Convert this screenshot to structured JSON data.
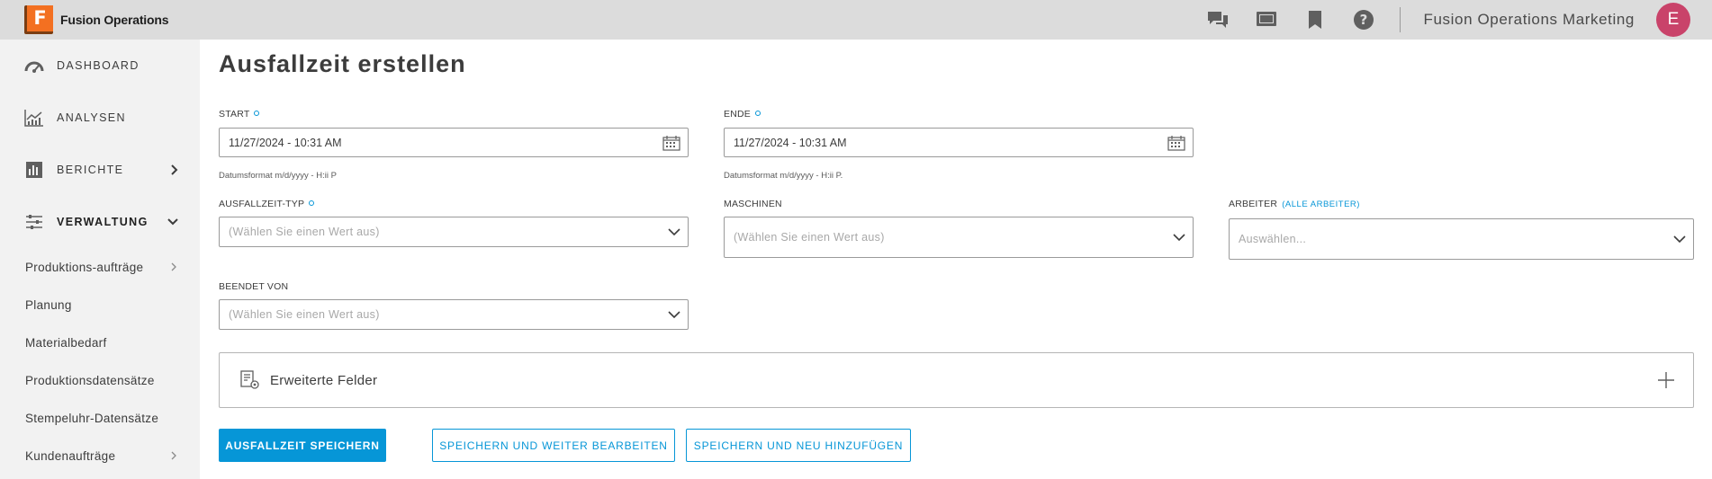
{
  "app": {
    "name": "Fusion Operations",
    "logo_letter": "F",
    "org": "Fusion Operations Marketing",
    "user_initial": "E",
    "accent": "#0696d7",
    "brand_color": "#f37021"
  },
  "topbar": {
    "icons": [
      "chat-icon",
      "presentation-icon",
      "bookmark-icon",
      "help-icon"
    ]
  },
  "sidebar": {
    "main_items": [
      {
        "label": "DASHBOARD",
        "icon": "dashboard-gauge-icon"
      },
      {
        "label": "ANALYSEN",
        "icon": "analytics-icon"
      },
      {
        "label": "BERICHTE",
        "icon": "reports-icon"
      },
      {
        "label": "VERWALTUNG",
        "icon": "sliders-icon"
      }
    ],
    "sub_items": [
      {
        "label": "Produktions-aufträge"
      },
      {
        "label": "Planung"
      },
      {
        "label": "Materialbedarf"
      },
      {
        "label": "Produktionsdatensätze"
      },
      {
        "label": "Stempeluhr-Datensätze"
      },
      {
        "label": "Kundenaufträge"
      }
    ]
  },
  "page": {
    "title": "Ausfallzeit erstellen"
  },
  "form": {
    "start": {
      "label": "START",
      "value": "11/27/2024 - 10:31 AM",
      "hint": "Datumsformat m/d/yyyy - H:ii P"
    },
    "ende": {
      "label": "ENDE",
      "value": "11/27/2024 - 10:31 AM",
      "hint": "Datumsformat m/d/yyyy - H:ii P."
    },
    "typ": {
      "label": "AUSFALLZEIT-TYP",
      "placeholder": "(Wählen Sie einen Wert aus)"
    },
    "maschinen": {
      "label": "MASCHINEN",
      "placeholder": "(Wählen Sie einen Wert aus)"
    },
    "arbeiter": {
      "label": "ARBEITER",
      "link": "(ALLE ARBEITER)",
      "placeholder": "Auswählen..."
    },
    "beendet": {
      "label": "BEENDET VON",
      "placeholder": "(Wählen Sie einen Wert aus)"
    },
    "extended": {
      "label": "Erweiterte Felder"
    }
  },
  "actions": {
    "save": "AUSFALLZEIT SPEICHERN",
    "save_continue": "SPEICHERN UND WEITER BEARBEITEN",
    "save_add": "SPEICHERN UND NEU HINZUFÜGEN"
  }
}
